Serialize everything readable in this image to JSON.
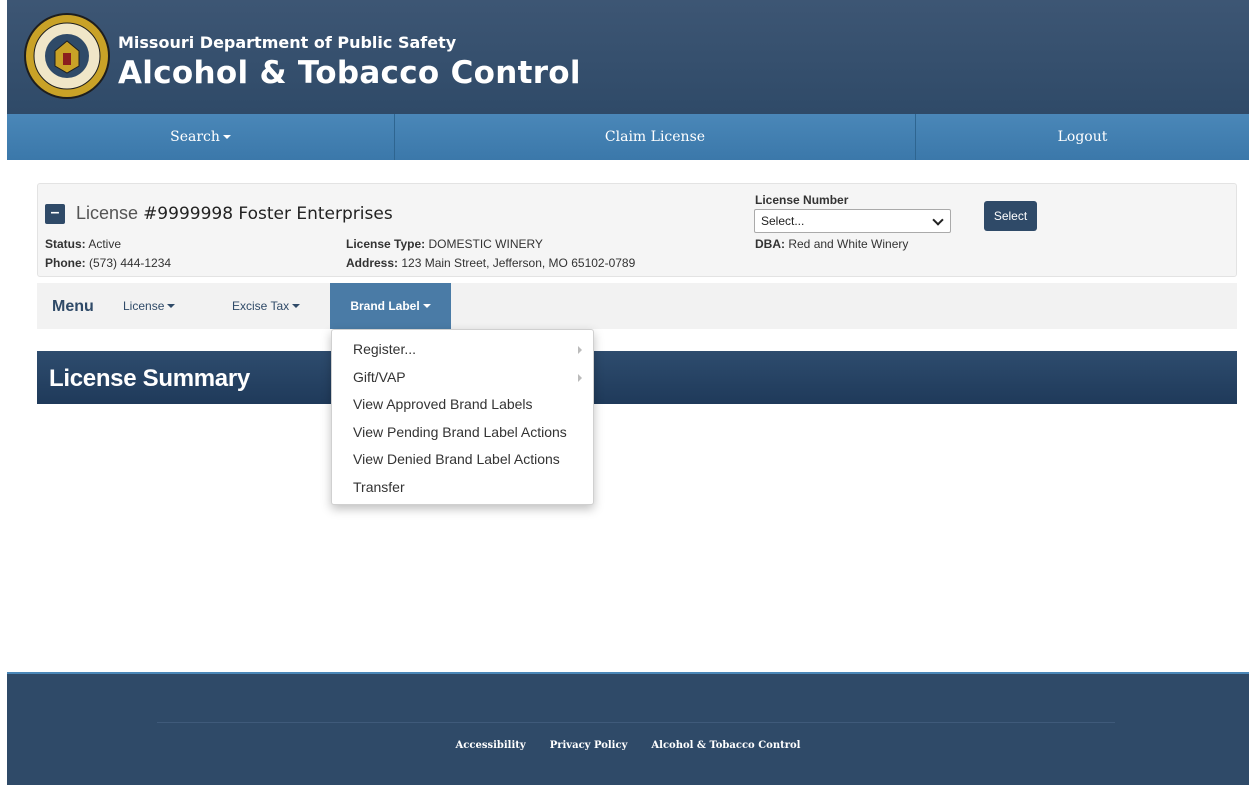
{
  "header": {
    "subtitle": "Missouri Department of Public Safety",
    "title": "Alcohol & Tobacco Control",
    "seal_text": "DEPT. OF PUBLIC SAFETY"
  },
  "topnav": {
    "search": "Search",
    "claim": "Claim License",
    "logout": "Logout"
  },
  "license": {
    "prefix": "License",
    "title": "#9999998 Foster Enterprises",
    "status_label": "Status:",
    "status": "Active",
    "phone_label": "Phone:",
    "phone": "(573) 444-1234",
    "type_label": "License Type:",
    "type": "DOMESTIC WINERY",
    "address_label": "Address:",
    "address": "123 Main Street, Jefferson, MO 65102-0789",
    "number_label": "License Number",
    "select_value": "Select...",
    "dba_label": "DBA:",
    "dba": "Red and White Winery",
    "select_button": "Select"
  },
  "menu": {
    "title": "Menu",
    "license": "License",
    "excise": "Excise Tax",
    "brand": "Brand Label"
  },
  "summary": {
    "title": "License Summary"
  },
  "dropdown": {
    "items": [
      {
        "label": "Register..."
      },
      {
        "label": "Gift/VAP"
      },
      {
        "label": "View Approved Brand Labels"
      },
      {
        "label": "View Pending Brand Label Actions"
      },
      {
        "label": "View Denied Brand Label Actions"
      },
      {
        "label": "Transfer"
      }
    ]
  },
  "footer": {
    "accessibility": "Accessibility",
    "privacy": "Privacy Policy",
    "atc": "Alcohol & Tobacco Control"
  },
  "colors": {
    "header": "#2f4a68",
    "nav": "#4a87b8",
    "accent": "#4a7ba6"
  }
}
